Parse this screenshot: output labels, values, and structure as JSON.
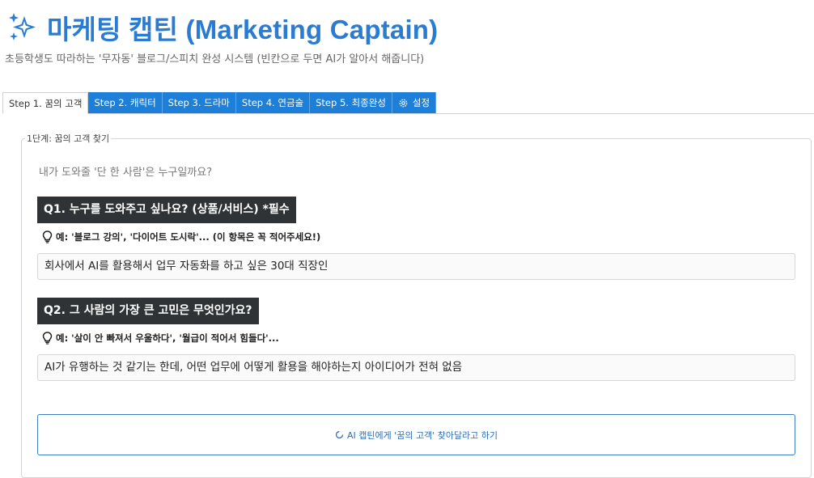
{
  "header": {
    "title": "마케팅 캡틴 (Marketing Captain)",
    "subtitle": "초등학생도 따라하는 '무자동' 블로그/스피치 완성 시스템 (빈칸으로 두면 AI가 알아서 해줍니다)",
    "logo_icon": "sparkles-icon",
    "accent_color": "#2a7cd3"
  },
  "tabs": [
    {
      "label": "Step 1. 꿈의 고객",
      "active": true
    },
    {
      "label": "Step 2. 캐릭터",
      "active": false
    },
    {
      "label": "Step 3. 드라마",
      "active": false
    },
    {
      "label": "Step 4. 연금술",
      "active": false
    },
    {
      "label": "Step 5. 최종완성",
      "active": false
    },
    {
      "label": "설정",
      "active": false,
      "icon": "gear-icon"
    }
  ],
  "panel": {
    "legend": "1단계: 꿈의 고객 찾기",
    "prompt": "내가 도와줄 '단 한 사람'은 누구일까요?"
  },
  "questions": [
    {
      "title": "Q1. 누구를 도와주고 싶나요? (상품/서비스) *필수",
      "hint": "예: '블로그 강의', '다이어트 도시락'... (이 항목은 꼭 적어주세요!)",
      "hint_icon": "lightbulb-icon",
      "value": "회사에서 AI를 활용해서 업무 자동화를 하고 싶은 30대 직장인"
    },
    {
      "title": "Q2. 그 사람의 가장 큰 고민은 무엇인가요?",
      "hint": "예: '살이 안 빠져서 우울하다', '월급이 적어서 힘들다'...",
      "hint_icon": "lightbulb-icon",
      "value": "AI가 유행하는 것 같기는 한데, 어떤 업무에 어떻게 활용을 해야하는지 아이디어가 전혀 없음"
    }
  ],
  "action": {
    "label": "AI 캡틴에게 '꿈의 고객' 찾아달라고 하기",
    "icon": "spinner-icon",
    "color": "#3c7fc6"
  }
}
